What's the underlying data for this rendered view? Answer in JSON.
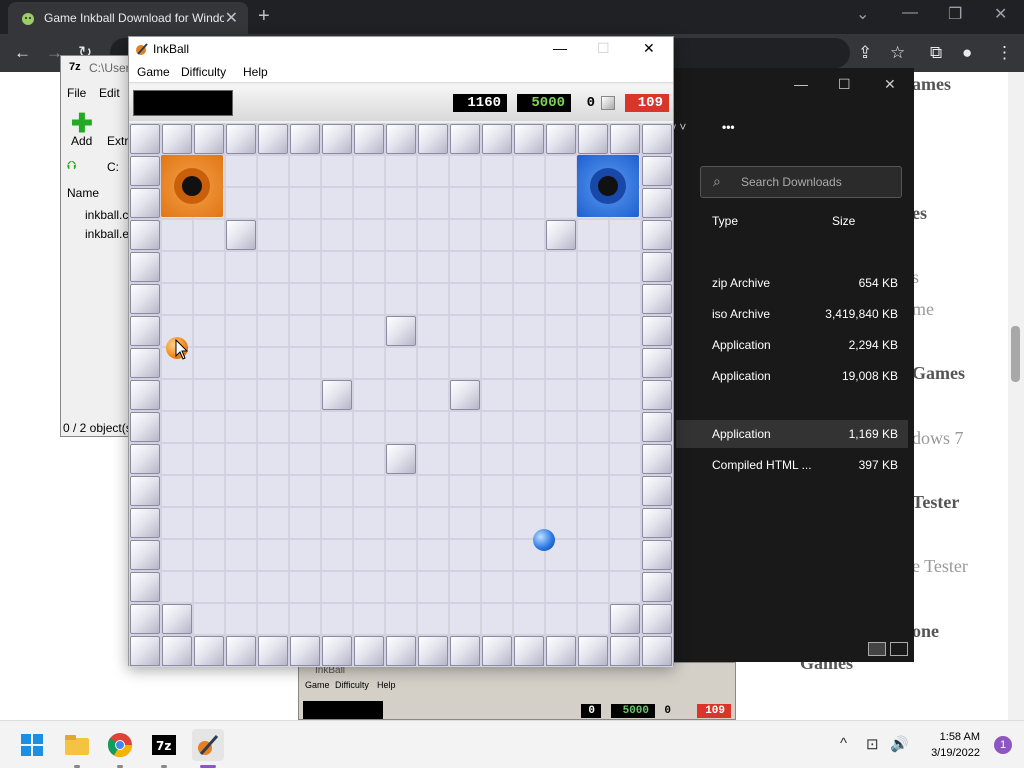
{
  "browser": {
    "tab_title": "Game Inkball Download for Windows",
    "tab_close": "✕",
    "new_tab": "+",
    "window_controls": [
      "⌄",
      "—",
      "❐",
      "✕"
    ],
    "nav": [
      "←",
      "→",
      "↻"
    ],
    "toolbar_icons": [
      "⇪",
      "☆",
      "⧉",
      "●",
      "⋮"
    ]
  },
  "page_background": {
    "fragments": [
      "ames",
      "es",
      "s",
      "me",
      "Games",
      "dows 7",
      "Tester",
      "e Tester",
      "one",
      "Games"
    ]
  },
  "explorer": {
    "window_controls": [
      "—",
      "☐",
      "✕"
    ],
    "view_label": "v ˅",
    "more": "•••",
    "search_placeholder": "Search Downloads",
    "columns": [
      "Type",
      "Size"
    ],
    "rows": [
      {
        "type": "zip Archive",
        "size": "654 KB"
      },
      {
        "type": "iso Archive",
        "size": "3,419,840 KB"
      },
      {
        "type": "Application",
        "size": "2,294 KB"
      },
      {
        "type": "Application",
        "size": "19,008 KB"
      },
      {
        "type": "Application",
        "size": "1,169 KB",
        "selected": true
      },
      {
        "type": "Compiled HTML ...",
        "size": "397 KB"
      }
    ]
  },
  "sevenzip": {
    "title": "C:\\User",
    "menu": [
      "File",
      "Edit"
    ],
    "add": "Add",
    "extract": "Extra",
    "path": "C:",
    "name_col": "Name",
    "files": [
      "inkball.c",
      "inkball.e"
    ],
    "status": "0 / 2 object(s"
  },
  "inkball": {
    "title": "InkBall",
    "menu": [
      "Game",
      "Difficulty",
      "Help"
    ],
    "controls": [
      "—",
      "☐",
      "✕"
    ],
    "score": "1160",
    "bonus": "5000",
    "balls_count": "0",
    "timer": "109",
    "colors": {
      "orange": "#f28a1e",
      "blue": "#2e7be6",
      "black_box": "#000000",
      "timer_bg": "#d9352b"
    }
  },
  "inkball2": {
    "title": "InkBall",
    "menu": [
      "Game",
      "Difficulty",
      "Help"
    ],
    "score": "0",
    "bonus": "5000",
    "balls_count": "0",
    "timer": "109"
  },
  "taskbar": {
    "time": "1:58 AM",
    "date": "3/19/2022",
    "notifications": "1",
    "tray": [
      "^",
      "⊡",
      "🔊"
    ]
  }
}
